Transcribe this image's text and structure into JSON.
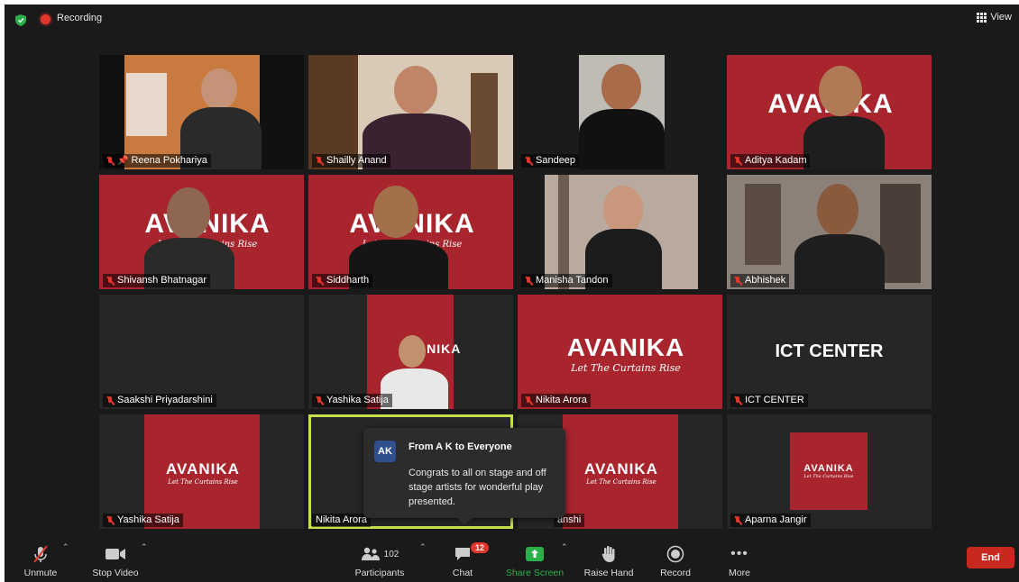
{
  "header": {
    "recording_label": "Recording",
    "view_label": "View"
  },
  "colors": {
    "brand_red": "#a8252e",
    "background": "#1a1a1a",
    "tile": "#262626",
    "active_border": "#c6e04e",
    "end_button": "#c8281e",
    "share_green": "#2ab04a"
  },
  "brand": {
    "logo_text": "AVANIKA",
    "tagline": "Let The Curtains Rise"
  },
  "participants": [
    {
      "name": "Reena Pokhariya",
      "pinned": true
    },
    {
      "name": "Shailly Anand"
    },
    {
      "name": "Sandeep"
    },
    {
      "name": "Aditya Kadam"
    },
    {
      "name": "Shivansh Bhatnagar"
    },
    {
      "name": "Siddharth"
    },
    {
      "name": "Manisha Tandon"
    },
    {
      "name": "Abhishek"
    },
    {
      "name": "Saakshi Priyadarshini"
    },
    {
      "name": "Yashika Satija"
    },
    {
      "name": "Nikita Arora"
    },
    {
      "name": "ICT CENTER",
      "display_text": "ICT CENTER"
    },
    {
      "name": "Yashika Satija"
    },
    {
      "name": "Nikita Arora"
    },
    {
      "name": "anshi"
    },
    {
      "name": "Aparna Jangir"
    }
  ],
  "chat_popup": {
    "avatar": "AK",
    "from": "From A K to Everyone",
    "message": "Congrats to all on stage and off stage artists for wonderful play presented."
  },
  "toolbar": {
    "unmute": "Unmute",
    "stop_video": "Stop Video",
    "participants": "Participants",
    "participants_count": "102",
    "chat": "Chat",
    "chat_badge": "12",
    "share_screen": "Share Screen",
    "raise_hand": "Raise Hand",
    "record": "Record",
    "more": "More",
    "end": "End"
  }
}
